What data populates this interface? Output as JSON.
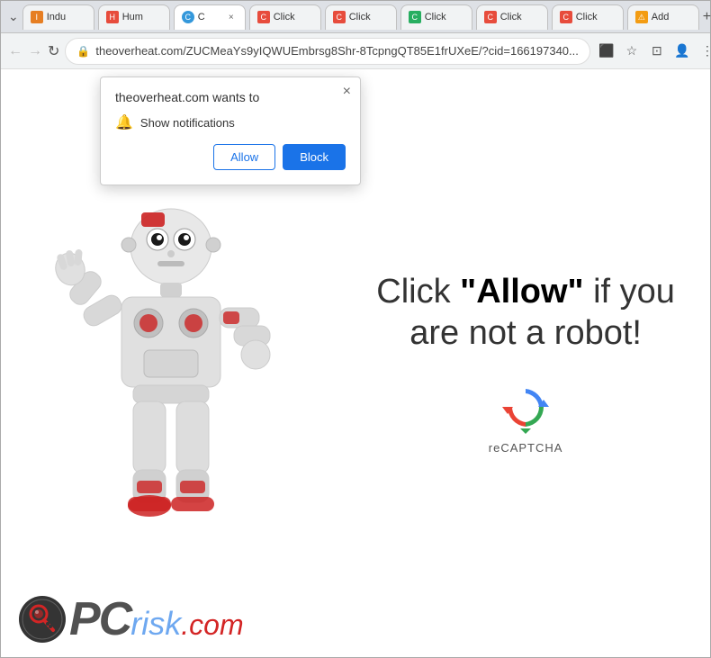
{
  "browser": {
    "tabs": [
      {
        "id": "tab1",
        "label": "Indu",
        "favicon_color": "#e67e22",
        "active": false
      },
      {
        "id": "tab2",
        "label": "Hum",
        "favicon_color": "#e74c3c",
        "active": false
      },
      {
        "id": "tab3",
        "label": "C",
        "favicon_color": "#3498db",
        "active": true,
        "show_close": true
      },
      {
        "id": "tab4",
        "label": "Click",
        "favicon_color": "#e74c3c",
        "active": false
      },
      {
        "id": "tab5",
        "label": "Click",
        "favicon_color": "#e74c3c",
        "active": false
      },
      {
        "id": "tab6",
        "label": "Click",
        "favicon_color": "#27ae60",
        "active": false
      },
      {
        "id": "tab7",
        "label": "Click",
        "favicon_color": "#e74c3c",
        "active": false
      },
      {
        "id": "tab8",
        "label": "Click",
        "favicon_color": "#e74c3c",
        "active": false
      },
      {
        "id": "tab9",
        "label": "Add",
        "favicon_color": "#f39c12",
        "active": false
      }
    ],
    "address_bar": {
      "url": "theoverheat.com/ZUCMeaYs9yIQWUEmbrsg8Shr-8TcpngQT85E1frUXeE/?cid=166197340...",
      "protocol": "https"
    }
  },
  "notification_popup": {
    "title": "theoverheat.com wants to",
    "permission_label": "Show notifications",
    "allow_button": "Allow",
    "block_button": "Block"
  },
  "page": {
    "captcha_text_before": "Click ",
    "captcha_text_bold": "\"Allow\"",
    "captcha_text_after": " if you are not a robot!",
    "recaptcha_label": "reCAPTCHA"
  },
  "pcrisk": {
    "brand": "PCrisk.com"
  },
  "icons": {
    "back": "←",
    "forward": "→",
    "refresh": "↻",
    "lock": "🔒",
    "star": "☆",
    "cast": "⊡",
    "profile": "👤",
    "menu": "⋮",
    "extensions": "⬛",
    "bell": "🔔",
    "close": "×",
    "new_tab": "+",
    "chevron": "⌄"
  }
}
